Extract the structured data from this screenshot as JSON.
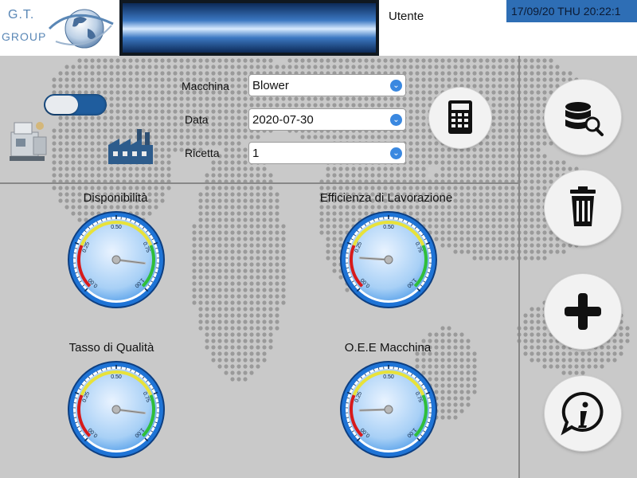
{
  "header": {
    "logo_line1": "G.T.",
    "logo_line2": "GROUP",
    "user_label": "Utente",
    "datetime": "17/09/20 THU 20:22:1"
  },
  "form": {
    "machine_label": "Macchina",
    "machine_value": "Blower",
    "date_label": "Data",
    "date_value": "2020-07-30",
    "recipe_label": "Ricetta",
    "recipe_value": "1"
  },
  "toggle": {
    "state": "on"
  },
  "gauges": [
    {
      "title": "Disponibilità",
      "value": 0.86
    },
    {
      "title": "Efficienza di Lavorazione",
      "value": 0.18
    },
    {
      "title": "Tasso di Qualità",
      "value": 0.86
    },
    {
      "title": "O.E.E Macchina",
      "value": 0.16
    }
  ],
  "gauge_ticks": [
    "0.00",
    "0.25",
    "0.50",
    "0.75",
    "1.00"
  ],
  "side_buttons": [
    {
      "icon": "database-search-icon"
    },
    {
      "icon": "trash-icon"
    },
    {
      "icon": "plus-icon"
    },
    {
      "icon": "info-icon"
    }
  ],
  "calculator_button": {
    "icon": "calculator-icon"
  },
  "colors": {
    "accent": "#2e6eb5",
    "gauge_blue": "#1f74d6",
    "gauge_red": "#d71b1b",
    "gauge_yellow": "#e8e23a",
    "gauge_green": "#2fbf3a"
  }
}
